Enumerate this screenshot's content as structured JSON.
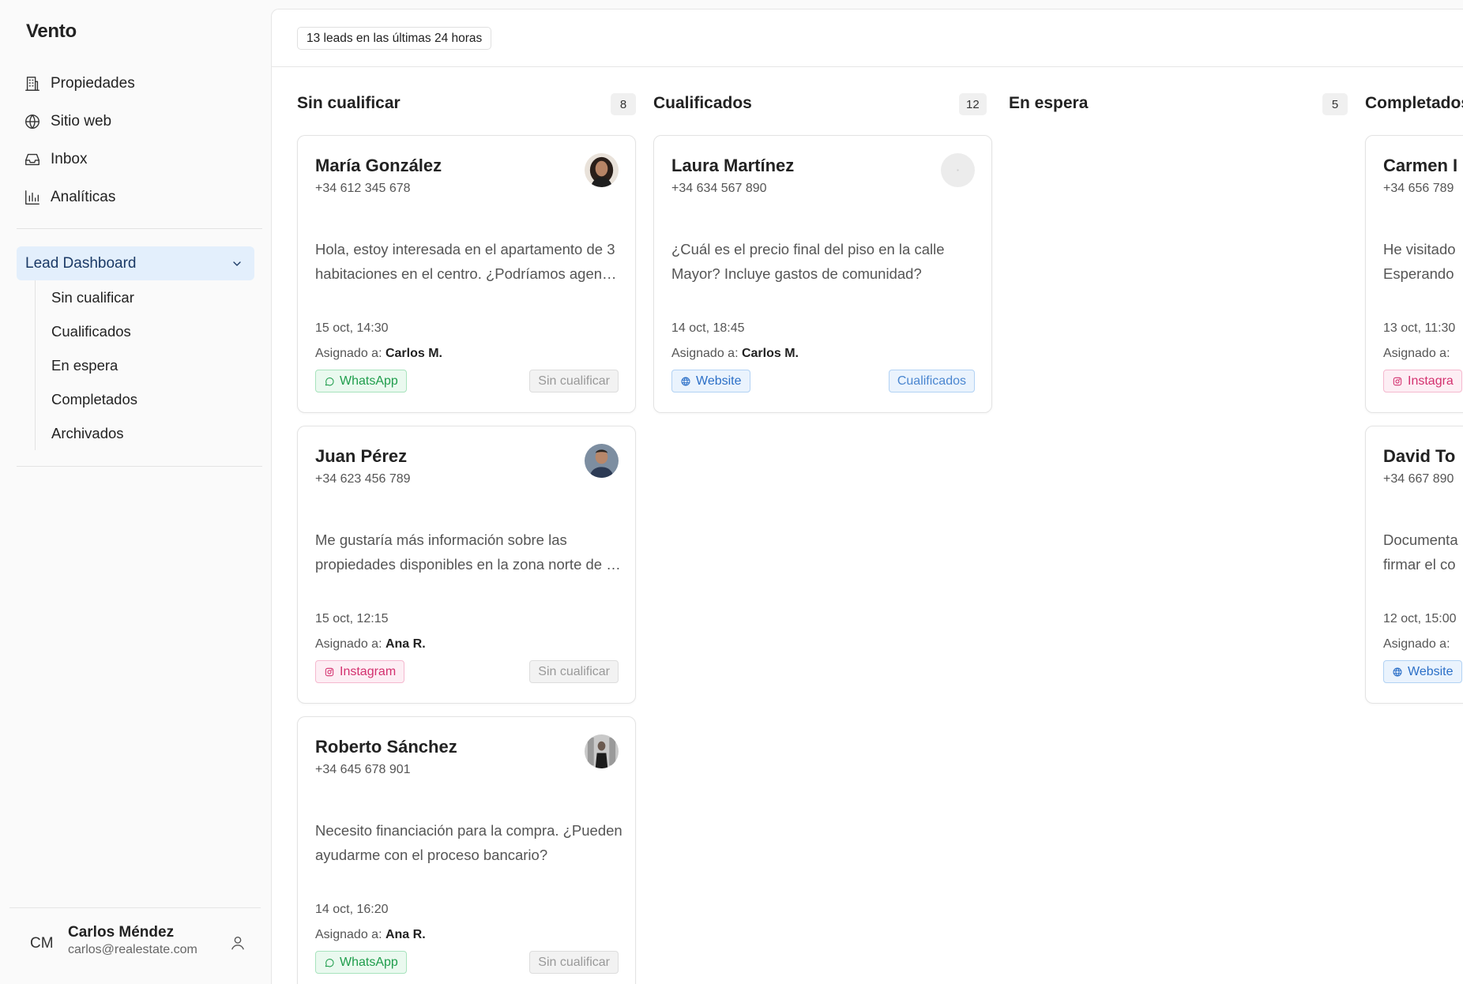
{
  "app": {
    "brand": "Vento"
  },
  "nav": {
    "items": [
      {
        "label": "Propiedades",
        "icon": "building-icon"
      },
      {
        "label": "Sitio web",
        "icon": "globe-icon"
      },
      {
        "label": "Inbox",
        "icon": "inbox-icon"
      },
      {
        "label": "Analíticas",
        "icon": "bar-chart-icon"
      }
    ],
    "lead_dashboard": {
      "label": "Lead Dashboard",
      "sub": [
        "Sin cualificar",
        "Cualificados",
        "En espera",
        "Completados",
        "Archivados"
      ]
    }
  },
  "user": {
    "initials": "CM",
    "name": "Carlos Méndez",
    "email": "carlos@realestate.com"
  },
  "header": {
    "summary": "13 leads en las últimas 24 horas"
  },
  "columns": [
    {
      "title": "Sin cualificar",
      "count": "8"
    },
    {
      "title": "Cualificados",
      "count": "12"
    },
    {
      "title": "En espera",
      "count": "5"
    },
    {
      "title": "Completados",
      "count": ""
    }
  ],
  "assigned_prefix": "Asignado a:",
  "cards": [
    {
      "name": "María González",
      "phone": "+34 612 345 678",
      "message": "Hola, estoy interesada en el apartamento de 3 habitaciones en el centro. ¿Podríamos agendar una visita?",
      "date": "15 oct, 14:30",
      "assignee": "Carlos M.",
      "source": "WhatsApp",
      "status": "Sin cualificar"
    },
    {
      "name": "Juan Pérez",
      "phone": "+34 623 456 789",
      "message": "Me gustaría más información sobre las propiedades disponibles en la zona norte de la ciudad.",
      "date": "15 oct, 12:15",
      "assignee": "Ana R.",
      "source": "Instagram",
      "status": "Sin cualificar"
    },
    {
      "name": "Roberto Sánchez",
      "phone": "+34 645 678 901",
      "message": "Necesito financiación para la compra. ¿Pueden ayudarme con el proceso bancario?",
      "date": "14 oct, 16:20",
      "assignee": "Ana R.",
      "source": "WhatsApp",
      "status": "Sin cualificar"
    },
    {
      "name": "Laura Martínez",
      "phone": "+34 634 567 890",
      "message": "¿Cuál es el precio final del piso en la calle Mayor? Incluye gastos de comunidad?",
      "date": "14 oct, 18:45",
      "assignee": "Carlos M.",
      "source": "Website",
      "status": "Cualificados"
    },
    {
      "name": "Carmen I",
      "phone": "+34 656 789",
      "message": "He visitado Esperando",
      "date": "13 oct, 11:30",
      "assignee": "",
      "source": "Instagra",
      "status": ""
    },
    {
      "name": "David To",
      "phone": "+34 667 890",
      "message": "Documenta firmar el co",
      "date": "12 oct, 15:00",
      "assignee": "",
      "source": "Website",
      "status": ""
    }
  ],
  "colors": {
    "accent": "#e3effc",
    "whatsapp": "#1f9d4c",
    "instagram": "#d3306e",
    "website": "#2b6fc7"
  }
}
